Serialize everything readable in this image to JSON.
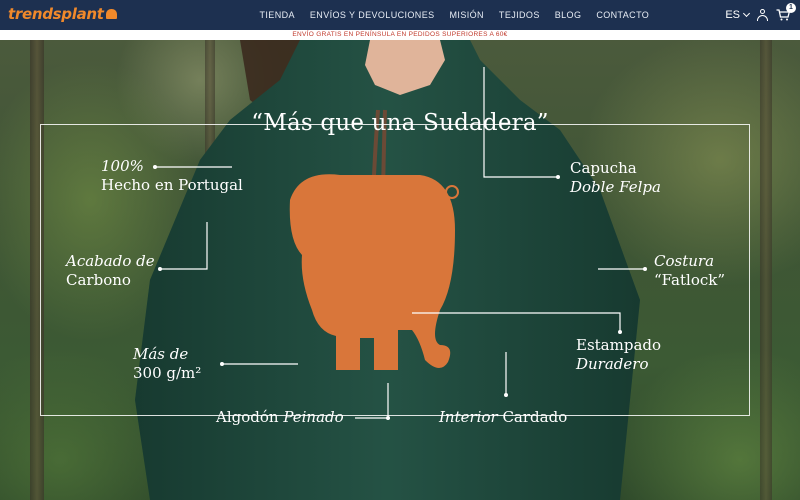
{
  "header": {
    "logo": "trendsplant",
    "nav": [
      "TIENDA",
      "ENVÍOS Y DEVOLUCIONES",
      "MISIÓN",
      "TEJIDOS",
      "BLOG",
      "CONTACTO"
    ],
    "language": "ES",
    "cart_count": "1"
  },
  "promo": "ENVÍO GRATIS EN PENÍNSULA EN PEDIDOS SUPERIORES A 60€",
  "hero": {
    "headline": "“Más que una Sudadera”",
    "features": {
      "portugal_1": "100%",
      "portugal_2": "Hecho en Portugal",
      "carbono_1": "Acabado de",
      "carbono_2": "Carbono",
      "gramaje_1": "Más de",
      "gramaje_2": "300 g/m²",
      "algodon_1": "Algodón",
      "algodon_2": "Peinado",
      "capucha_1": "Capucha",
      "capucha_2": "Doble Felpa",
      "costura_1": "Costura",
      "costura_2": "“Fatlock”",
      "estampado_1": "Estampado",
      "estampado_2": "Duradero",
      "interior_1": "Interior",
      "interior_2": "Cardado"
    }
  },
  "colors": {
    "navbar": "#1d3050",
    "logo": "#f0892b",
    "hoodie": "#1f4a3e",
    "print": "#d9763a",
    "promo_text": "#c0392b"
  }
}
